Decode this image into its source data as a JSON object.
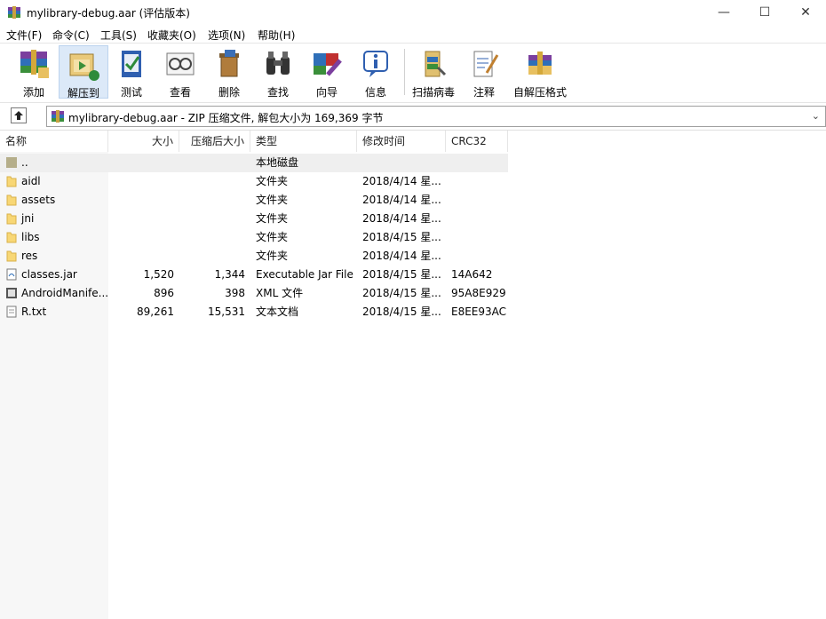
{
  "window": {
    "title": "mylibrary-debug.aar (评估版本)",
    "minimize": "—",
    "maximize": "☐",
    "close": "✕"
  },
  "menu": [
    "文件(F)",
    "命令(C)",
    "工具(S)",
    "收藏夹(O)",
    "选项(N)",
    "帮助(H)"
  ],
  "toolbar": [
    {
      "label": "添加",
      "icon": "add-archive-icon"
    },
    {
      "label": "解压到",
      "icon": "extract-to-icon"
    },
    {
      "label": "测试",
      "icon": "test-icon"
    },
    {
      "label": "查看",
      "icon": "view-icon"
    },
    {
      "label": "删除",
      "icon": "delete-icon"
    },
    {
      "label": "查找",
      "icon": "find-icon"
    },
    {
      "label": "向导",
      "icon": "wizard-icon"
    },
    {
      "label": "信息",
      "icon": "info-icon"
    },
    {
      "label": "扫描病毒",
      "icon": "virus-scan-icon"
    },
    {
      "label": "注释",
      "icon": "comment-icon"
    },
    {
      "label": "自解压格式",
      "icon": "sfx-icon"
    }
  ],
  "path": {
    "text": "mylibrary-debug.aar - ZIP 压缩文件, 解包大小为 169,369 字节"
  },
  "columns": [
    "名称",
    "大小",
    "压缩后大小",
    "类型",
    "修改时间",
    "CRC32"
  ],
  "files": [
    {
      "name": "..",
      "size": "",
      "packed": "",
      "type": "本地磁盘",
      "modified": "",
      "crc": "",
      "kind": "parent"
    },
    {
      "name": "aidl",
      "size": "",
      "packed": "",
      "type": "文件夹",
      "modified": "2018/4/14 星...",
      "crc": "",
      "kind": "folder"
    },
    {
      "name": "assets",
      "size": "",
      "packed": "",
      "type": "文件夹",
      "modified": "2018/4/14 星...",
      "crc": "",
      "kind": "folder"
    },
    {
      "name": "jni",
      "size": "",
      "packed": "",
      "type": "文件夹",
      "modified": "2018/4/14 星...",
      "crc": "",
      "kind": "folder"
    },
    {
      "name": "libs",
      "size": "",
      "packed": "",
      "type": "文件夹",
      "modified": "2018/4/15 星...",
      "crc": "",
      "kind": "folder"
    },
    {
      "name": "res",
      "size": "",
      "packed": "",
      "type": "文件夹",
      "modified": "2018/4/14 星...",
      "crc": "",
      "kind": "folder"
    },
    {
      "name": "classes.jar",
      "size": "1,520",
      "packed": "1,344",
      "type": "Executable Jar File",
      "modified": "2018/4/15 星...",
      "crc": "14A642",
      "kind": "jar"
    },
    {
      "name": "AndroidManife...",
      "size": "896",
      "packed": "398",
      "type": "XML 文件",
      "modified": "2018/4/15 星...",
      "crc": "95A8E929",
      "kind": "xml"
    },
    {
      "name": "R.txt",
      "size": "89,261",
      "packed": "15,531",
      "type": "文本文档",
      "modified": "2018/4/15 星...",
      "crc": "E8EE93AC",
      "kind": "txt"
    }
  ]
}
